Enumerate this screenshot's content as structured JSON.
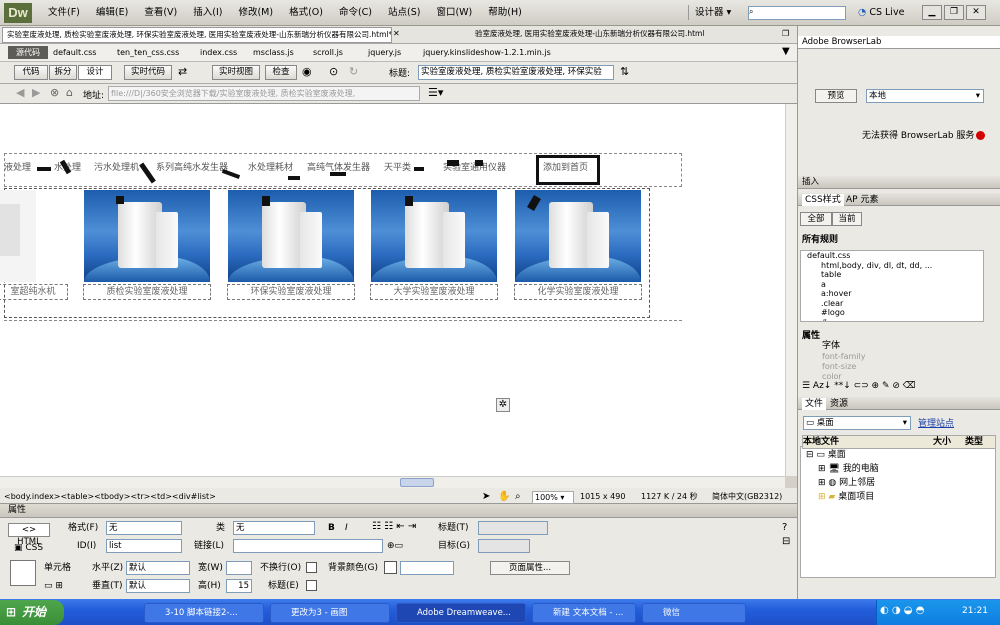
{
  "app": {
    "logo": "Dw"
  },
  "menu": [
    "文件(F)",
    "编辑(E)",
    "查看(V)",
    "插入(I)",
    "修改(M)",
    "格式(O)",
    "命令(C)",
    "站点(S)",
    "窗口(W)",
    "帮助(H)"
  ],
  "header": {
    "workspace": "设计器",
    "cslive": "CS Live"
  },
  "doc_tabs": {
    "active": "实验室废液处理, 质检实验室废液处理, 环保实验室废液处理, 医用实验室废液处理-山东新瑞分析仪器有限公司.html*",
    "second": "验室废液处理, 医用实验室废液处理-山东新瑞分析仪器有限公司.html"
  },
  "related_files": {
    "source": "源代码",
    "files": [
      "default.css",
      "ten_ten_css.css",
      "index.css",
      "msclass.js",
      "scroll.js",
      "jquery.js",
      "jquery.kinslideshow-1.2.1.min.js"
    ]
  },
  "toolbar": {
    "code": "代码",
    "split": "拆分",
    "design": "设计",
    "live_code": "实时代码",
    "live_view": "实时视图",
    "inspect": "检查",
    "title_label": "标题:",
    "title_value": "实验室废液处理, 质检实验室废液处理, 环保实验"
  },
  "address": {
    "label": "地址:",
    "value": "file:///D|/360安全浏览器下载/实验室废液处理, 质检实验室废液处理,"
  },
  "canvas": {
    "nav_items": [
      "液处理",
      "水处理",
      "污水处理机",
      "系列高纯水发生器",
      "水处理耗材",
      "高纯气体发生器",
      "天平类",
      "实验室通用仪器",
      "添加到首页"
    ],
    "captions": [
      "室超纯水机",
      "质检实验室废液处理",
      "环保实验室废液处理",
      "大学实验室废液处理",
      "化学实验室废液处理"
    ]
  },
  "statusbar": {
    "tags": "<body.index><table><tbody><tr><td><div#list>",
    "zoom": "100%",
    "size": "1015 x 490",
    "filesize": "1127 K / 24 秒",
    "encoding": "简体中文(GB2312)"
  },
  "properties": {
    "title": "属性",
    "html": "HTML",
    "css": "CSS",
    "format_label": "格式(F)",
    "format_value": "无",
    "class_label": "类",
    "class_value": "无",
    "id_label": "ID(I)",
    "id_value": "list",
    "link_label": "链接(L)",
    "title_label": "标题(T)",
    "target_label": "目标(G)",
    "cell_label": "单元格",
    "horz_label": "水平(Z)",
    "horz_value": "默认",
    "vert_label": "垂直(T)",
    "vert_value": "默认",
    "width_label": "宽(W)",
    "height_label": "高(H)",
    "height_value": "15",
    "nowrap_label": "不换行(O)",
    "header_label": "标题(E)",
    "bg_label": "背景颜色(G)",
    "page_props": "页面属性..."
  },
  "panel": {
    "browserlab": "Adobe BrowserLab",
    "preview": "预览",
    "local": "本地",
    "browserlab_msg": "无法获得 BrowserLab 服务",
    "insert": "插入",
    "css_tab": "CSS样式",
    "ap_tab": "AP 元素",
    "all": "全部",
    "current": "当前",
    "all_rules": "所有规则",
    "rules": [
      "default.css",
      "html,body, div, dl, dt, dd, ...",
      "table",
      "a",
      "a:hover",
      ".clear",
      "#logo",
      "#..."
    ],
    "props_title": "属性",
    "font": "字体",
    "font_family": "font-family",
    "font_size": "font-size",
    "color": "color",
    "files_tab": "文件",
    "assets_tab": "资源",
    "desktop": "桌面",
    "manage_sites": "管理站点",
    "local_files": "本地文件",
    "size_col": "大小",
    "type_col": "类型",
    "tree": [
      "桌面",
      "我的电脑",
      "网上邻居",
      "桌面项目"
    ]
  },
  "taskbar": {
    "start": "开始",
    "tasks": [
      "3-10 脚本链接2-...",
      "更改为3 - 画图",
      "Adobe Dreamweave...",
      "新建 文本文档 - ...",
      "微信"
    ],
    "clock": "21:21"
  },
  "colors": {
    "accent": "#245edb",
    "canvas": "#ffffff",
    "chrome": "#ebe9e3"
  }
}
